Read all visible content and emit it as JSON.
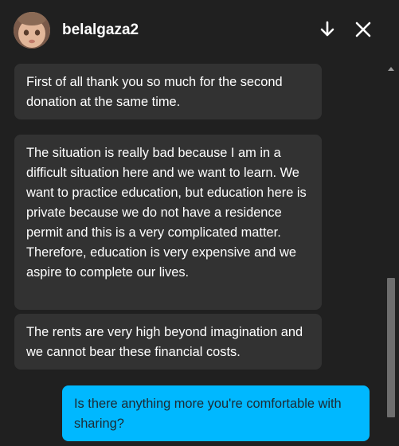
{
  "header": {
    "username": "belalgaza2",
    "avatar_icon": "user-avatar-icon",
    "minimize_icon": "arrow-down-icon",
    "close_icon": "close-icon"
  },
  "messages": [
    {
      "direction": "incoming",
      "text": "First of all thank you so much for the second donation at the same time."
    },
    {
      "direction": "incoming",
      "text": "The situation is really bad because I am in a difficult situation here and we want to learn. We want to practice education, but education here is private because we do not have a residence permit and this is a very complicated matter. Therefore, education is very expensive and we aspire to complete our lives."
    },
    {
      "direction": "incoming",
      "text": "The rents are very high beyond imagination and we cannot bear these financial costs."
    },
    {
      "direction": "outgoing",
      "text": "Is there anything more you're comfortable with sharing?"
    }
  ],
  "colors": {
    "background": "#202020",
    "incoming_bubble": "#323232",
    "outgoing_bubble": "#00b8ff",
    "text": "#ffffff"
  }
}
